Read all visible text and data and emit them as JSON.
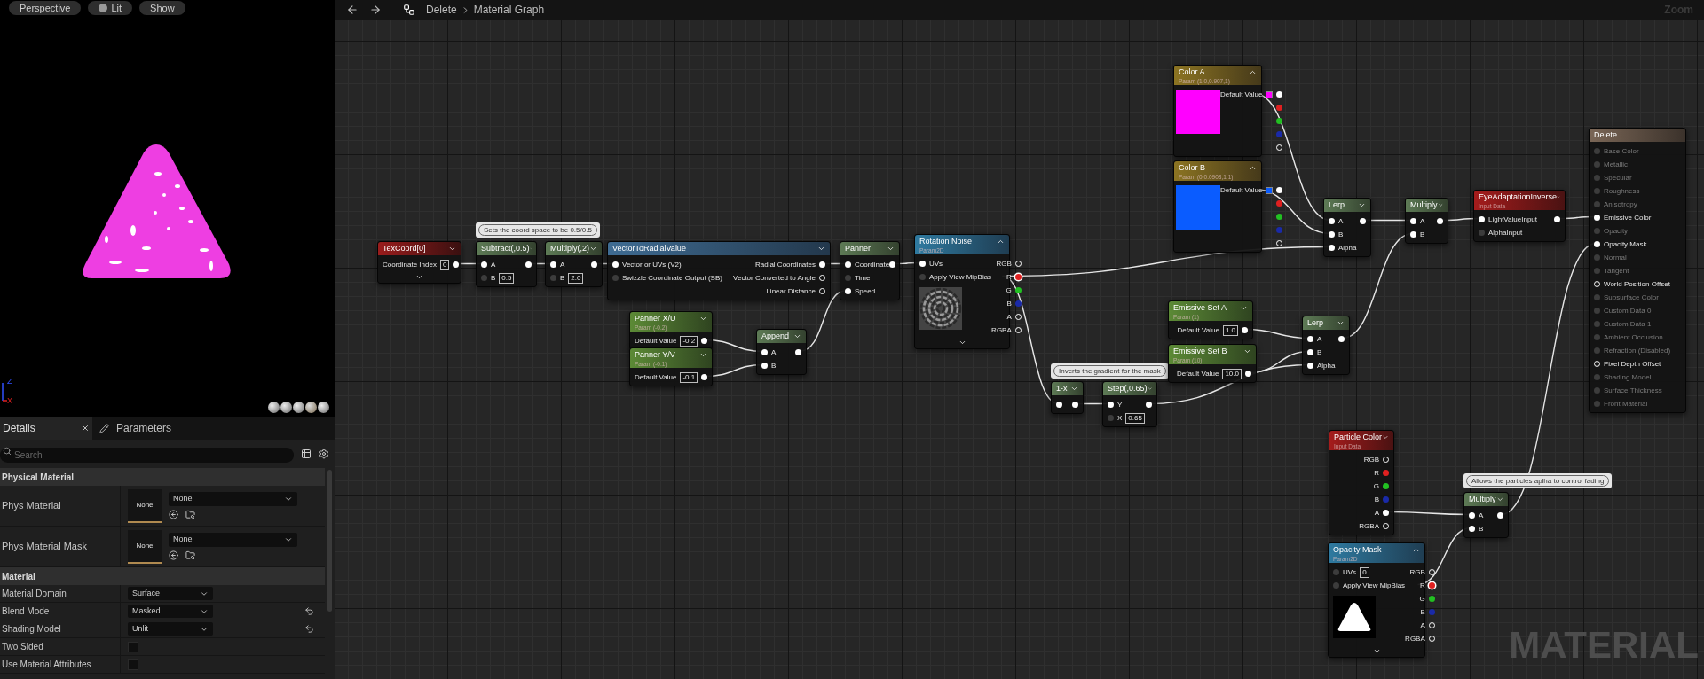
{
  "viewport": {
    "buttons": [
      {
        "label": "Perspective",
        "icon": false
      },
      {
        "label": "Lit",
        "icon": true
      },
      {
        "label": "Show",
        "icon": false
      }
    ],
    "axis_labels": [
      "Z",
      "X"
    ]
  },
  "details": {
    "tabs": [
      {
        "label": "Details",
        "selected": true,
        "closable": true
      },
      {
        "label": "Parameters",
        "selected": false,
        "closable": false
      }
    ],
    "search": {
      "placeholder": "Search"
    },
    "sections": [
      {
        "title": "Physical Material",
        "rows": [
          {
            "kind": "asset",
            "label": "Phys Material",
            "thumbnail": "None",
            "value": "None"
          },
          {
            "kind": "asset",
            "label": "Phys Material Mask",
            "thumbnail": "None",
            "value": "None"
          }
        ]
      },
      {
        "title": "Material",
        "rows": [
          {
            "kind": "dropdown",
            "label": "Material Domain",
            "value": "Surface",
            "modified": false
          },
          {
            "kind": "dropdown",
            "label": "Blend Mode",
            "value": "Masked",
            "modified": true
          },
          {
            "kind": "dropdown",
            "label": "Shading Model",
            "value": "Unlit",
            "modified": true
          },
          {
            "kind": "checkbox",
            "label": "Two Sided",
            "checked": false
          },
          {
            "kind": "checkbox",
            "label": "Use Material Attributes",
            "checked": false
          }
        ]
      }
    ]
  },
  "graph": {
    "breadcrumb": [
      "Delete",
      "Material Graph"
    ],
    "zoom": "Zoom",
    "corner_label": "MATERIAL",
    "comments": [
      {
        "text": "Sets the coord space to be 0.5/0.5"
      },
      {
        "text": "Inverts the gradient for the mask"
      },
      {
        "text": "Allows the particles aplha to control fading"
      }
    ],
    "nodes": [
      {
        "kind": "coordinate",
        "title": "TexCoord[0]",
        "outputs": [
          {
            "label": "Coordinate Index",
            "value": "0",
            "connected": true
          }
        ],
        "advanced": true
      },
      {
        "kind": "math",
        "title": "Subtract(,0.5)",
        "inputs": [
          {
            "label": "A",
            "connected": true
          },
          {
            "label": "B",
            "value": "0.5",
            "connected": false
          }
        ],
        "outputs": [
          {
            "connected": true
          }
        ],
        "advanced": false
      },
      {
        "kind": "math",
        "title": "Multiply(,2)",
        "inputs": [
          {
            "label": "A",
            "connected": true
          },
          {
            "label": "B",
            "value": "2.0",
            "connected": false
          }
        ],
        "outputs": [
          {
            "connected": true
          }
        ],
        "advanced": false
      },
      {
        "kind": "function",
        "title": "VectorToRadialValue",
        "inputs": [
          {
            "label": "Vector or UVs (V2)",
            "connected": true
          },
          {
            "label": "Swizzle Coordinate Output (SB)",
            "connected": false
          }
        ],
        "outputs": [
          {
            "label": "Radial Coordinates",
            "connected": true
          },
          {
            "label": "Vector Converted to Angle",
            "connected": false
          },
          {
            "label": "Linear Distance",
            "connected": false
          }
        ],
        "advanced": false
      },
      {
        "kind": "math",
        "title": "Panner",
        "inputs": [
          {
            "label": "Coordinate",
            "connected": true
          },
          {
            "label": "Time",
            "connected": false
          },
          {
            "label": "Speed",
            "connected": true
          }
        ],
        "outputs": [
          {
            "connected": true
          }
        ],
        "advanced": false
      },
      {
        "kind": "texture_param",
        "title": "Rotation Noise",
        "subtitle": "Param2D",
        "preview": {
          "kind": "noise"
        },
        "advanced": true,
        "inputs": [
          {
            "label": "UVs",
            "connected": true
          },
          {
            "label": "Apply View MipBias",
            "connected": false
          }
        ],
        "outputs": [
          {
            "label": "RGB",
            "connected": false
          },
          {
            "label": "R",
            "color": "#e02020",
            "connected": true
          },
          {
            "label": "G",
            "color": "#22c022",
            "connected": false
          },
          {
            "label": "B",
            "color": "#1a2aa8",
            "connected": false
          },
          {
            "label": "A",
            "connected": false
          },
          {
            "label": "RGBA",
            "connected": false
          }
        ]
      },
      {
        "kind": "scalar_param",
        "title": "Panner X/U",
        "subtitle": "Param (-0.2)",
        "outputs": [
          {
            "label": "Default Value",
            "value": "-0.2",
            "connected": true
          }
        ],
        "advanced": false
      },
      {
        "kind": "scalar_param",
        "title": "Panner Y/V",
        "subtitle": "Param (-0.1)",
        "outputs": [
          {
            "label": "Default Value",
            "value": "-0.1",
            "connected": true
          }
        ],
        "advanced": false
      },
      {
        "kind": "math",
        "title": "Append",
        "inputs": [
          {
            "label": "A",
            "connected": true
          },
          {
            "label": "B",
            "connected": true
          }
        ],
        "outputs": [
          {
            "connected": true
          }
        ],
        "advanced": false
      },
      {
        "kind": "vector_param",
        "title": "Color A",
        "subtitle": "Param (1,0,0.907,1)",
        "preview": {
          "kind": "swatch"
        },
        "color": "#ff00ff",
        "outputs": [
          {
            "label": "Default Value",
            "swatch": true,
            "connected": true
          },
          {
            "color": "#e02020",
            "connected": false
          },
          {
            "color": "#22c022",
            "connected": false
          },
          {
            "color": "#1a2aa8",
            "connected": false
          },
          {
            "connected": false
          }
        ],
        "advanced": false
      },
      {
        "kind": "vector_param",
        "title": "Color B",
        "subtitle": "Param (0,0.0908,1,1)",
        "preview": {
          "kind": "swatch"
        },
        "color": "#0a5cff",
        "outputs": [
          {
            "label": "Default Value",
            "swatch": true,
            "connected": true
          },
          {
            "color": "#e02020",
            "connected": false
          },
          {
            "color": "#22c022",
            "connected": false
          },
          {
            "color": "#1a2aa8",
            "connected": false
          },
          {
            "connected": false
          }
        ],
        "advanced": false
      },
      {
        "kind": "math",
        "title": "Lerp",
        "inputs": [
          {
            "label": "A",
            "connected": true
          },
          {
            "label": "B",
            "connected": true
          },
          {
            "label": "Alpha",
            "connected": true
          }
        ],
        "outputs": [
          {
            "connected": true
          }
        ],
        "advanced": false
      },
      {
        "kind": "math",
        "title": "Multiply",
        "inputs": [
          {
            "label": "A",
            "connected": true
          },
          {
            "label": "B",
            "connected": true
          }
        ],
        "outputs": [
          {
            "connected": true
          }
        ],
        "advanced": false
      },
      {
        "kind": "input",
        "title": "EyeAdaptationInverse",
        "subtitle": "Input Data",
        "inputs": [
          {
            "label": "LightValueInput",
            "connected": true
          },
          {
            "label": "AlphaInput",
            "connected": false
          }
        ],
        "outputs": [
          {
            "connected": true
          }
        ],
        "advanced": false
      },
      {
        "kind": "result",
        "title": "Delete",
        "inputs": [
          {
            "label": "Base Color",
            "disabled": true,
            "connected": false
          },
          {
            "label": "Metallic",
            "disabled": true,
            "connected": false
          },
          {
            "label": "Specular",
            "disabled": true,
            "connected": false
          },
          {
            "label": "Roughness",
            "disabled": true,
            "connected": false
          },
          {
            "label": "Anisotropy",
            "disabled": true,
            "connected": false
          },
          {
            "label": "Emissive Color",
            "disabled": false,
            "connected": true
          },
          {
            "label": "Opacity",
            "disabled": true,
            "connected": false
          },
          {
            "label": "Opacity Mask",
            "disabled": false,
            "connected": true
          },
          {
            "label": "Normal",
            "disabled": true,
            "connected": false
          },
          {
            "label": "Tangent",
            "disabled": true,
            "connected": false
          },
          {
            "label": "World Position Offset",
            "disabled": false,
            "connected": false
          },
          {
            "label": "Subsurface Color",
            "disabled": true,
            "connected": false
          },
          {
            "label": "Custom Data 0",
            "disabled": true,
            "connected": false
          },
          {
            "label": "Custom Data 1",
            "disabled": true,
            "connected": false
          },
          {
            "label": "Ambient Occlusion",
            "disabled": true,
            "connected": false
          },
          {
            "label": "Refraction (Disabled)",
            "disabled": true,
            "connected": false
          },
          {
            "label": "Pixel Depth Offset",
            "disabled": false,
            "connected": false
          },
          {
            "label": "Shading Model",
            "disabled": true,
            "connected": false
          },
          {
            "label": "Surface Thickness",
            "disabled": true,
            "connected": false
          },
          {
            "label": "Front Material",
            "disabled": true,
            "connected": false
          }
        ],
        "advanced": false
      },
      {
        "kind": "scalar_param",
        "title": "Emissive Set A",
        "subtitle": "Param (1)",
        "outputs": [
          {
            "label": "Default Value",
            "value": "1.0",
            "connected": true
          }
        ],
        "advanced": false
      },
      {
        "kind": "scalar_param",
        "title": "Emissive Set B",
        "subtitle": "Param (10)",
        "outputs": [
          {
            "label": "Default Value",
            "value": "10.0",
            "connected": true
          }
        ],
        "advanced": false
      },
      {
        "kind": "math",
        "title": "Lerp",
        "inputs": [
          {
            "label": "A",
            "connected": true
          },
          {
            "label": "B",
            "connected": true
          },
          {
            "label": "Alpha",
            "connected": true
          }
        ],
        "outputs": [
          {
            "connected": true
          }
        ],
        "advanced": false
      },
      {
        "kind": "math",
        "title": "1-x",
        "inputs": [
          {
            "connected": true
          }
        ],
        "outputs": [
          {
            "connected": true
          }
        ],
        "advanced": false
      },
      {
        "kind": "math",
        "title": "Step(,0.65)",
        "inputs": [
          {
            "label": "Y",
            "connected": true
          },
          {
            "label": "X",
            "value": "0.65",
            "connected": false
          }
        ],
        "outputs": [
          {
            "connected": true
          }
        ],
        "advanced": false
      },
      {
        "kind": "input",
        "title": "Particle Color",
        "subtitle": "Input Data",
        "outputs": [
          {
            "label": "RGB",
            "connected": false
          },
          {
            "label": "R",
            "color": "#e02020",
            "connected": false
          },
          {
            "label": "G",
            "color": "#22c022",
            "connected": false
          },
          {
            "label": "B",
            "color": "#1a2aa8",
            "connected": false
          },
          {
            "label": "A",
            "connected": true
          },
          {
            "label": "RGBA",
            "connected": false
          }
        ],
        "advanced": false
      },
      {
        "kind": "math",
        "title": "Multiply",
        "inputs": [
          {
            "label": "A",
            "connected": true
          },
          {
            "label": "B",
            "connected": true
          }
        ],
        "outputs": [
          {
            "connected": true
          }
        ],
        "advanced": false
      },
      {
        "kind": "texture_param",
        "title": "Opacity Mask",
        "subtitle": "Param2D",
        "preview": {
          "kind": "triangle"
        },
        "advanced": true,
        "inputs": [
          {
            "label": "UVs",
            "value": "0",
            "connected": false
          },
          {
            "label": "Apply View MipBias",
            "connected": false
          }
        ],
        "outputs": [
          {
            "label": "RGB",
            "connected": false
          },
          {
            "label": "R",
            "color": "#e02020",
            "connected": true
          },
          {
            "label": "G",
            "color": "#22c022",
            "connected": false
          },
          {
            "label": "B",
            "color": "#1a2aa8",
            "connected": false
          },
          {
            "label": "A",
            "connected": false
          },
          {
            "label": "RGBA",
            "connected": false
          }
        ]
      }
    ]
  }
}
